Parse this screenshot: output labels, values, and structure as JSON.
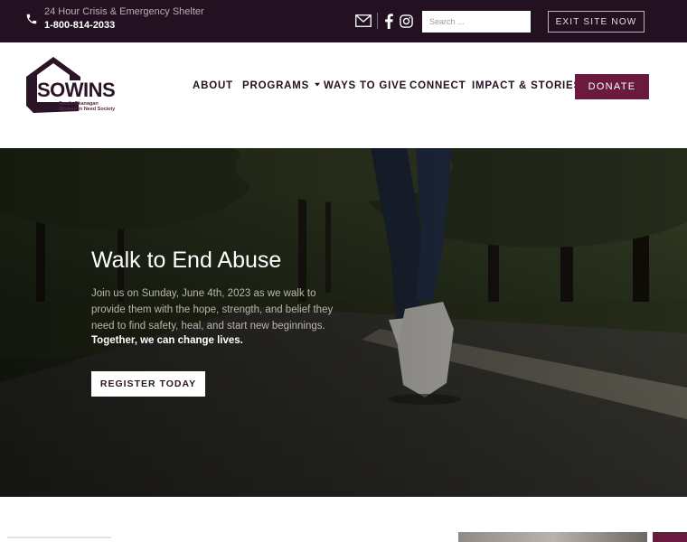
{
  "topbar": {
    "crisis_label": "24 Hour Crisis & Emergency Shelter",
    "phone": "1-800-814-2033",
    "search_placeholder": "Search ...",
    "exit_label": "EXIT SITE NOW",
    "icons": [
      "phone-icon",
      "mail-icon",
      "facebook-icon",
      "instagram-icon"
    ]
  },
  "logo": {
    "word": "SOWINS",
    "tagline_line1": "South Okanagan",
    "tagline_line2": "Women In Need Society"
  },
  "nav": {
    "about": "ABOUT",
    "programs": "PROGRAMS",
    "ways_to_give": "WAYS TO GIVE",
    "connect": "CONNECT",
    "impact": "IMPACT & STORIES",
    "donate": "DONATE"
  },
  "hero": {
    "title": "Walk to End Abuse",
    "body": "Join us on Sunday, June 4th, 2023 as we walk to provide them with the hope, strength, and belief they need to find safety, heal, and start new beginnings.",
    "strong": "Together, we can change lives.",
    "cta": "REGISTER TODAY"
  },
  "colors": {
    "topbar_bg": "#231020",
    "brand_plum": "#6b1a3f",
    "logo_dark": "#2a1426"
  }
}
